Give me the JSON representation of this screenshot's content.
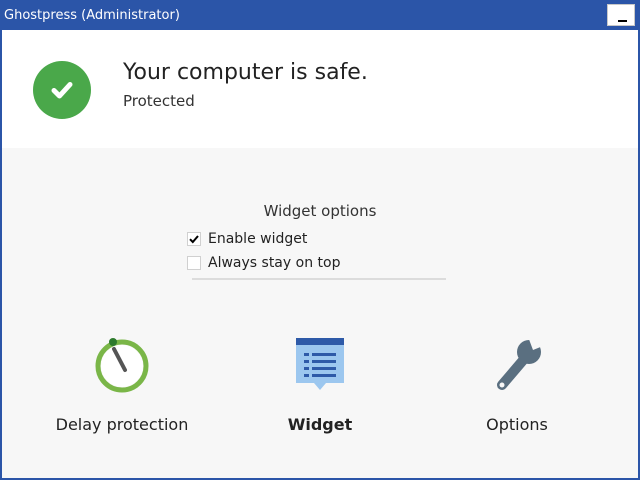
{
  "window": {
    "title": "Ghostpress (Administrator)",
    "minimize_symbol": "_"
  },
  "status": {
    "icon": "checkmark-icon",
    "title": "Your computer is safe.",
    "subtitle": "Protected",
    "color": "#4aa84a"
  },
  "widget_options": {
    "heading": "Widget options",
    "items": [
      {
        "label": "Enable widget",
        "checked": true
      },
      {
        "label": "Always stay on top",
        "checked": false
      }
    ]
  },
  "actions": [
    {
      "label": "Delay protection",
      "icon": "timer-icon",
      "selected": false
    },
    {
      "label": "Widget",
      "icon": "widget-icon",
      "selected": true
    },
    {
      "label": "Options",
      "icon": "wrench-icon",
      "selected": false
    }
  ],
  "colors": {
    "titlebar": "#2b55a8",
    "timer_green": "#7ab648",
    "widget_blue": "#9cc7ef",
    "wrench_slate": "#5a6f80"
  }
}
